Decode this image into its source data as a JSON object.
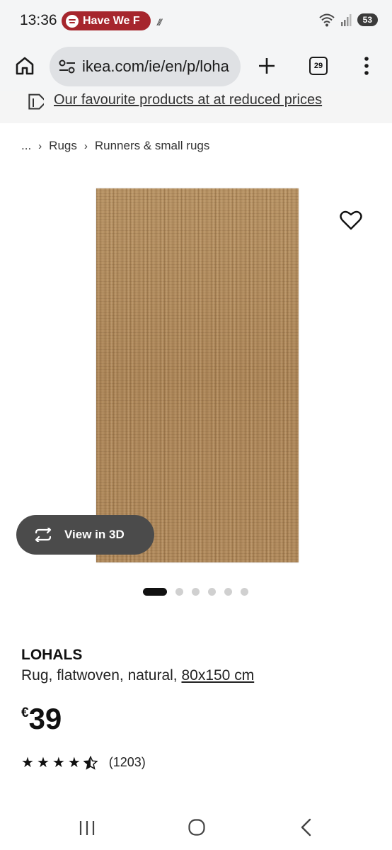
{
  "status_bar": {
    "time": "13:36",
    "media_pill_text": "Have We F",
    "battery": "53",
    "icons": [
      "wifi-icon",
      "signal-icon",
      "battery-icon",
      "spotify-icon"
    ]
  },
  "browser": {
    "url": "ikea.com/ie/en/p/loha",
    "tab_count": "29",
    "icons": [
      "home-icon",
      "site-settings-icon",
      "plus-icon",
      "tabs-icon",
      "more-vert-icon"
    ]
  },
  "promo": {
    "text": "Our favourite products at at reduced prices"
  },
  "breadcrumb": {
    "items": [
      "...",
      "Rugs",
      "Runners & small rugs"
    ]
  },
  "product": {
    "view3d_label": "View in 3D",
    "image_count": 6,
    "active_image": 1,
    "name": "LOHALS",
    "description": "Rug, flatwoven, natural, ",
    "size": "80x150 cm",
    "currency": "€",
    "price": "39",
    "rating": 4.5,
    "rating_count": "(1203)"
  },
  "colors": {
    "spotify_pill": "#a6262d",
    "url_box": "#dfe1e4",
    "bar_bg": "#f4f5f6",
    "view3d_bg": "#4b4b4b",
    "rug": "#b58f63"
  }
}
